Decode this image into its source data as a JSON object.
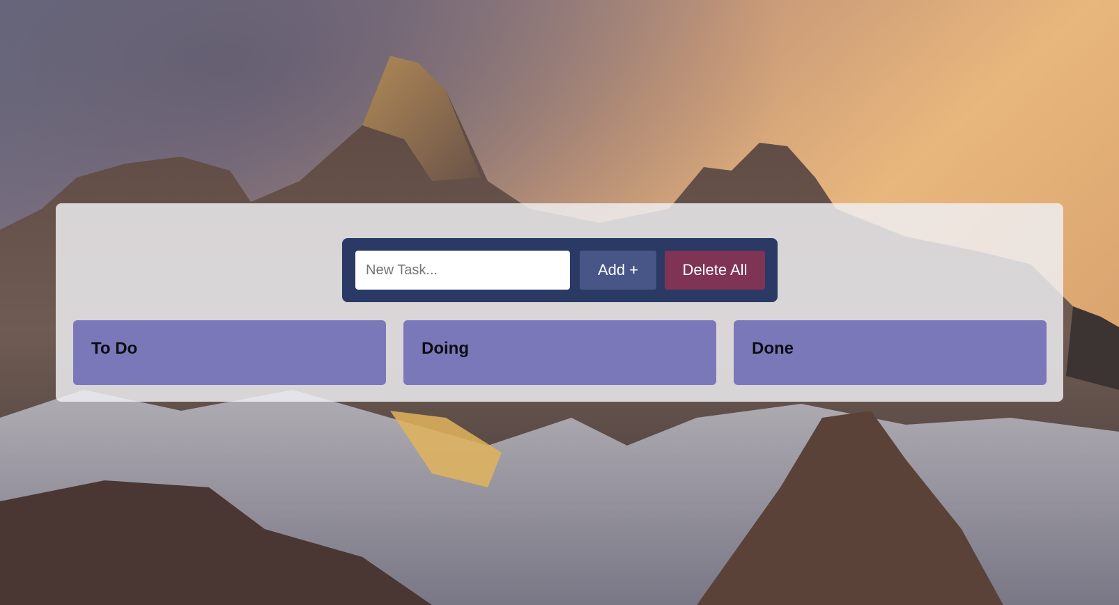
{
  "colors": {
    "panel_bg": "#eeeef2",
    "controls_bg": "#2a3a64",
    "add_button": "#485687",
    "delete_button": "#7f3355",
    "column_bg": "#7a78b8"
  },
  "background": {
    "description_icon": "mountain-landscape-image"
  },
  "task_form": {
    "input_placeholder": "New Task...",
    "input_value": "",
    "add_label": "Add +",
    "delete_all_label": "Delete All"
  },
  "columns": [
    {
      "title": "To Do"
    },
    {
      "title": "Doing"
    },
    {
      "title": "Done"
    }
  ]
}
